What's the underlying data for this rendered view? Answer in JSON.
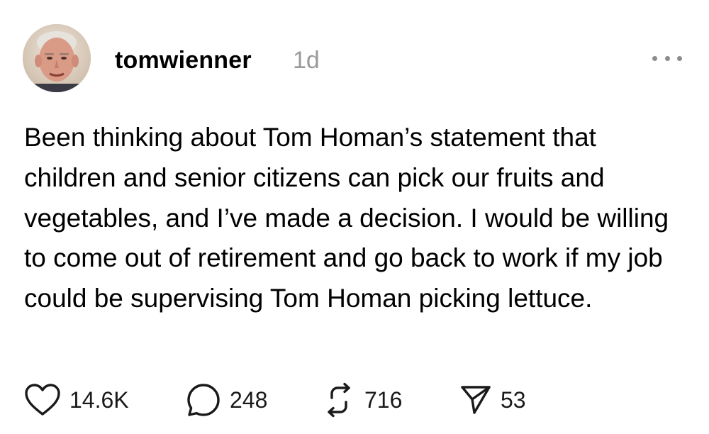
{
  "post": {
    "username": "tomwienner",
    "time_ago": "1d",
    "body": "Been thinking about Tom Homan’s statement that children and senior citizens can pick our fruits and vegetables, and I’ve made a decision. I would be willing to come out of retirement and go back to work if my job could be supervising Tom Homan picking lettuce.",
    "more_icon": "more-horizontal-icon"
  },
  "actions": {
    "likes": "14.6K",
    "replies": "248",
    "reposts": "716",
    "shares": "53",
    "icons": [
      "heart-icon",
      "comment-icon",
      "repost-icon",
      "send-icon"
    ]
  },
  "colors": {
    "text": "#000000",
    "muted": "#9a9a9a",
    "icon": "#1a1a1a",
    "background": "#ffffff"
  }
}
